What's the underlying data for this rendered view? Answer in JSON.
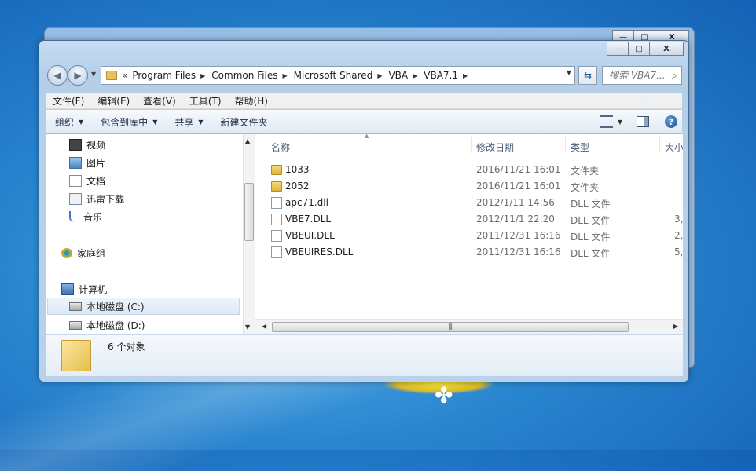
{
  "window": {
    "minimize": "—",
    "maximize": "□",
    "close": "X"
  },
  "address": {
    "chevron": "«",
    "crumbs": [
      "Program Files",
      "Common Files",
      "Microsoft Shared",
      "VBA",
      "VBA7.1"
    ],
    "search_placeholder": "搜索 VBA7..."
  },
  "menu": [
    "文件(F)",
    "编辑(E)",
    "查看(V)",
    "工具(T)",
    "帮助(H)"
  ],
  "toolbar": {
    "organize": "组织",
    "include": "包含到库中",
    "share": "共享",
    "new_folder": "新建文件夹"
  },
  "nav": {
    "items": [
      "视频",
      "图片",
      "文档",
      "迅雷下载",
      "音乐"
    ],
    "homegroup": "家庭组",
    "computer": "计算机",
    "drives": [
      "本地磁盘 (C:)",
      "本地磁盘 (D:)"
    ]
  },
  "columns": {
    "name": "名称",
    "modified": "修改日期",
    "type": "类型",
    "size": "大小"
  },
  "files": [
    {
      "name": "1033",
      "modified": "2016/11/21 16:01",
      "type": "文件夹",
      "size": "",
      "icon": "folder-icon"
    },
    {
      "name": "2052",
      "modified": "2016/11/21 16:01",
      "type": "文件夹",
      "size": "",
      "icon": "folder-icon"
    },
    {
      "name": "apc71.dll",
      "modified": "2012/1/11 14:56",
      "type": "DLL 文件",
      "size": "",
      "icon": "file-icon"
    },
    {
      "name": "VBE7.DLL",
      "modified": "2012/11/1 22:20",
      "type": "DLL 文件",
      "size": "3,",
      "icon": "file-icon"
    },
    {
      "name": "VBEUI.DLL",
      "modified": "2011/12/31 16:16",
      "type": "DLL 文件",
      "size": "2,",
      "icon": "file-icon"
    },
    {
      "name": "VBEUIRES.DLL",
      "modified": "2011/12/31 16:16",
      "type": "DLL 文件",
      "size": "5,",
      "icon": "file-icon"
    }
  ],
  "status": {
    "count": "6 个对象"
  },
  "colors": {
    "desktop": "#2a86d0",
    "window_frame": "#b9d1ea",
    "selection": "#dde8f5"
  }
}
